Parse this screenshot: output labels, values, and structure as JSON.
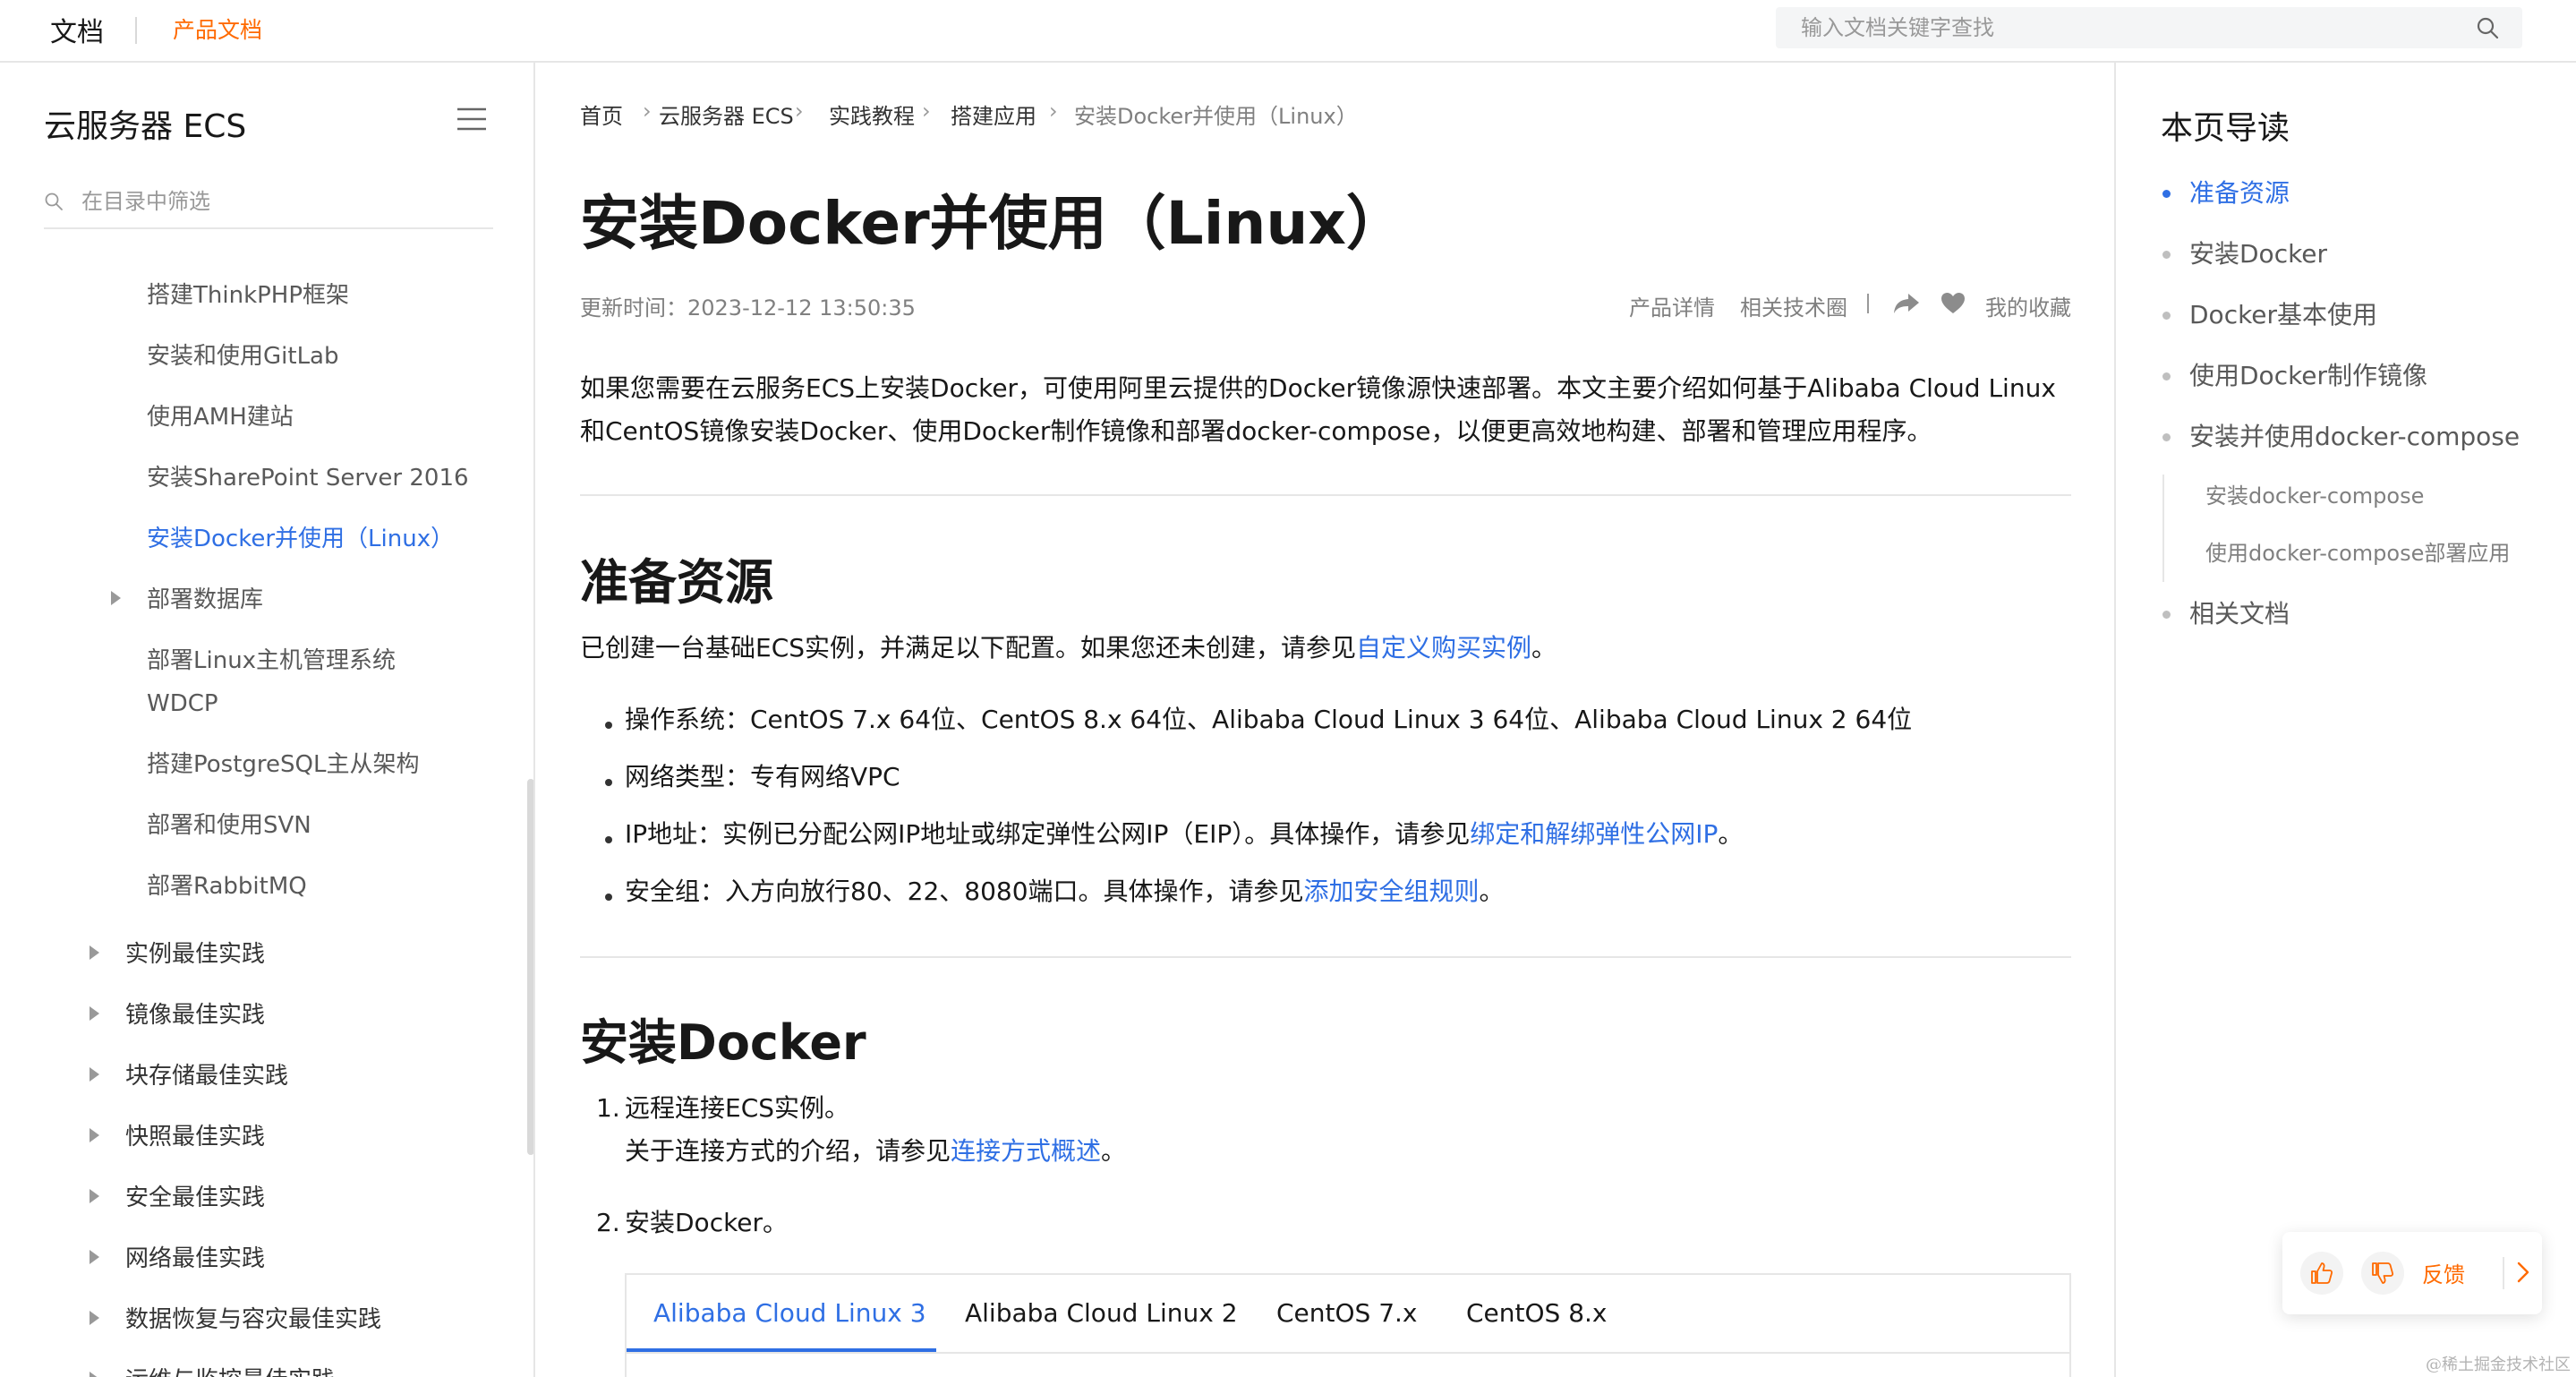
{
  "topbar": {
    "brand": "文档",
    "product_docs": "产品文档",
    "search_placeholder": "输入文档关键字查找",
    "accent_color": "#ff6a00"
  },
  "sidebar": {
    "title": "云服务器 ECS",
    "filter_placeholder": "在目录中筛选",
    "items": [
      {
        "label": "搭建ThinkPHP框架"
      },
      {
        "label": "安装和使用GitLab"
      },
      {
        "label": "使用AMH建站"
      },
      {
        "label": "安装SharePoint Server 2016"
      },
      {
        "label": "安装Docker并使用（Linux）",
        "active": true
      },
      {
        "label": "部署数据库",
        "expandable": true
      },
      {
        "label": "部署Linux主机管理系统",
        "label2": "WDCP"
      },
      {
        "label": "搭建PostgreSQL主从架构"
      },
      {
        "label": "部署和使用SVN"
      },
      {
        "label": "部署RabbitMQ"
      }
    ],
    "sections": [
      {
        "label": "实例最佳实践"
      },
      {
        "label": "镜像最佳实践"
      },
      {
        "label": "块存储最佳实践"
      },
      {
        "label": "快照最佳实践"
      },
      {
        "label": "安全最佳实践"
      },
      {
        "label": "网络最佳实践"
      },
      {
        "label": "数据恢复与容灾最佳实践"
      },
      {
        "label": "运维与监控最佳实践"
      }
    ]
  },
  "breadcrumb": [
    "首页",
    "云服务器 ECS",
    "实践教程",
    "搭建应用",
    "安装Docker并使用（Linux）"
  ],
  "article": {
    "title": "安装Docker并使用（Linux）",
    "updated": "更新时间：2023-12-12 13:50:35",
    "meta_links": {
      "product_detail": "产品详情",
      "tech_circle": "相关技术圈",
      "favorites": "我的收藏"
    },
    "intro_line1": "如果您需要在云服务ECS上安装Docker，可使用阿里云提供的Docker镜像源快速部署。本文主要介绍如何基于Alibaba Cloud Linux",
    "intro_line2": "和CentOS镜像安装Docker、使用Docker制作镜像和部署docker-compose，以便更高效地构建、部署和管理应用程序。",
    "section1": {
      "heading": "准备资源",
      "para_text": "已创建一台基础ECS实例，并满足以下配置。如果您还未创建，请参见",
      "para_link": "自定义购买实例",
      "para_end": "。",
      "bullets": [
        {
          "text": "操作系统：CentOS 7.x 64位、CentOS 8.x 64位、Alibaba Cloud Linux 3 64位、Alibaba Cloud Linux 2 64位"
        },
        {
          "text": "网络类型：专有网络VPC"
        },
        {
          "text": "IP地址：实例已分配公网IP地址或绑定弹性公网IP（EIP）。具体操作，请参见",
          "link": "绑定和解绑弹性公网IP",
          "end": "。"
        },
        {
          "text": "安全组：入方向放行80、22、8080端口。具体操作，请参见",
          "link": "添加安全组规则",
          "end": "。"
        }
      ]
    },
    "section2": {
      "heading": "安装Docker",
      "steps": [
        {
          "num": "1.",
          "text": "远程连接ECS实例。",
          "sub_text": "关于连接方式的介绍，请参见",
          "sub_link": "连接方式概述",
          "sub_end": "。"
        },
        {
          "num": "2.",
          "text": "安装Docker。"
        }
      ],
      "tabs": [
        "Alibaba Cloud Linux 3",
        "Alibaba Cloud Linux 2",
        "CentOS 7.x",
        "CentOS 8.x"
      ],
      "active_tab": 0
    },
    "link_color": "#2f6fe4"
  },
  "toc": {
    "title": "本页导读",
    "items": [
      {
        "label": "准备资源",
        "active": true
      },
      {
        "label": "安装Docker"
      },
      {
        "label": "Docker基本使用"
      },
      {
        "label": "使用Docker制作镜像"
      },
      {
        "label": "安装并使用docker-compose"
      }
    ],
    "sub_items": [
      "安装docker-compose",
      "使用docker-compose部署应用"
    ],
    "last_item": "相关文档"
  },
  "feedback": {
    "label": "反馈",
    "thumbs_up_icon": "thumbs-up-icon",
    "thumbs_down_icon": "thumbs-down-icon"
  },
  "watermark": "@稀土掘金技术社区"
}
